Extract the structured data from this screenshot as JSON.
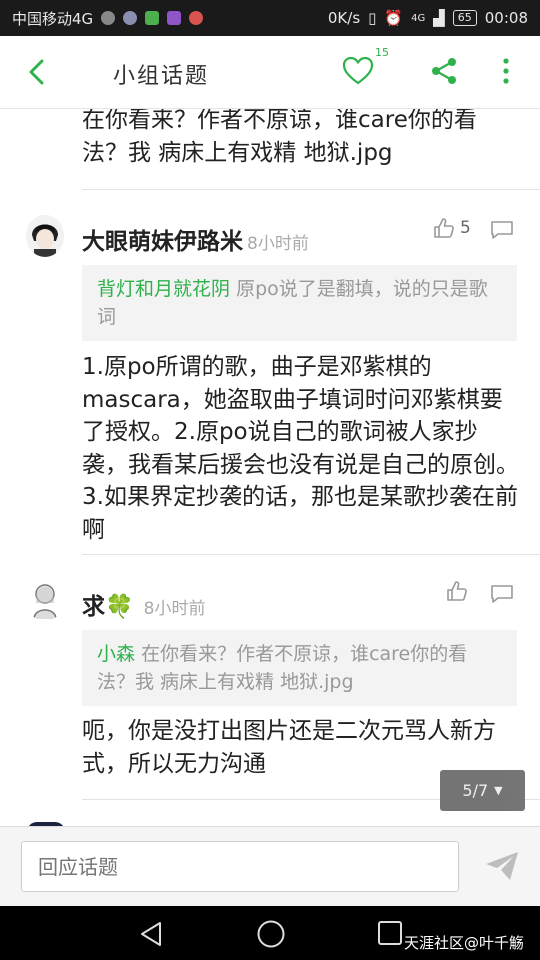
{
  "status_bar": {
    "carrier": "中国移动4G",
    "speed": "0K/s",
    "network": "4G",
    "battery": "65",
    "time": "00:08"
  },
  "header": {
    "title": "小组话题",
    "like_count": "15"
  },
  "content": {
    "top_text": "在你看来？作者不原谅，谁care你的看法？我 病床上有戏精 地狱.jpg",
    "comments": [
      {
        "username": "大眼萌妹伊路米",
        "time": "8小时前",
        "likes": "5",
        "quote_author": "背灯和月就花阴",
        "quote_text": "原po说了是翻填，说的只是歌词",
        "text": "1.原po所谓的歌，曲子是邓紫棋的mascara，她盗取曲子填词时问邓紫棋要了授权。2.原po说自己的歌词被人家抄袭，我看某后援会也没有说是自己的原创。3.如果界定抄袭的话，那也是某歌抄袭在前啊"
      },
      {
        "username": "求🍀",
        "time": "8小时前",
        "likes": "",
        "quote_author": "小森",
        "quote_text": "在你看来？作者不原谅，谁care你的看法？我 病床上有戏精 地狱.jpg",
        "text": "呃，你是没打出图片还是二次元骂人新方式，所以无力沟通"
      }
    ]
  },
  "pager": {
    "label": "5/7"
  },
  "reply_bar": {
    "placeholder": "回应话题"
  },
  "watermark": "天涯社区@叶千觞",
  "colors": {
    "accent": "#2fb14c",
    "quote_bg": "#f3f3f3",
    "meta_gray": "#aaaaaa"
  },
  "icons": [
    "back-arrow-icon",
    "heart-icon",
    "share-icon",
    "more-vert-icon",
    "thumb-up-icon",
    "comment-icon",
    "send-icon",
    "nav-back-icon",
    "nav-home-icon",
    "nav-recent-icon"
  ]
}
